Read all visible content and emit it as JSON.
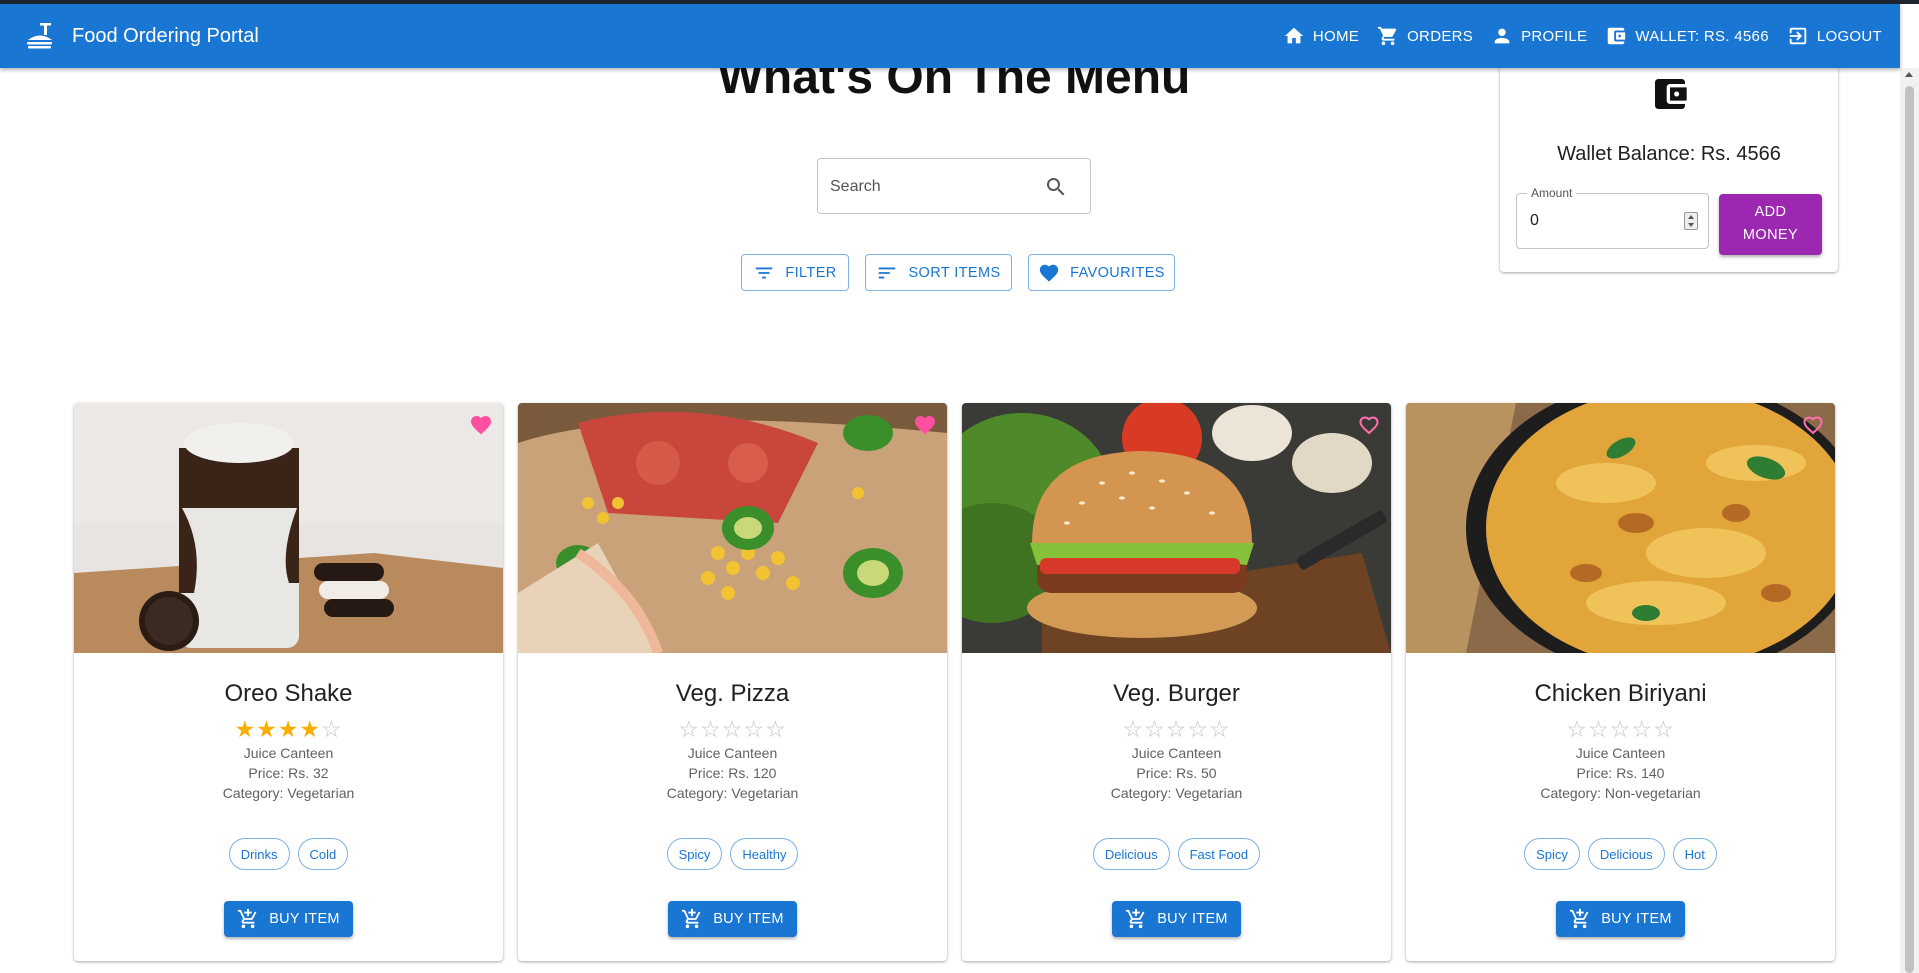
{
  "app": {
    "title": "Food Ordering Portal",
    "brand_color": "#1976d2"
  },
  "nav": {
    "home": "HOME",
    "orders": "ORDERS",
    "profile": "PROFILE",
    "wallet": "WALLET: RS. 4566",
    "logout": "LOGOUT"
  },
  "menu": {
    "title": "What's On The Menu",
    "search_placeholder": "Search",
    "filter_label": "FILTER",
    "sort_label": "SORT ITEMS",
    "favourites_label": "FAVOURITES"
  },
  "wallet": {
    "balance_text": "Wallet Balance: Rs. 4566",
    "amount_label": "Amount",
    "amount_value": "0",
    "add_money_line1": "ADD",
    "add_money_line2": "MONEY",
    "button_color": "#9c27b0"
  },
  "items": [
    {
      "name": "Oreo Shake",
      "rating": 4,
      "canteen": "Juice Canteen",
      "price": "Price: Rs. 32",
      "category": "Category: Vegetarian",
      "tags": [
        "Drinks",
        "Cold"
      ],
      "favourite": true,
      "buy_label": "BUY ITEM"
    },
    {
      "name": "Veg. Pizza",
      "rating": 0,
      "canteen": "Juice Canteen",
      "price": "Price: Rs. 120",
      "category": "Category: Vegetarian",
      "tags": [
        "Spicy",
        "Healthy"
      ],
      "favourite": true,
      "buy_label": "BUY ITEM"
    },
    {
      "name": "Veg. Burger",
      "rating": 0,
      "canteen": "Juice Canteen",
      "price": "Price: Rs. 50",
      "category": "Category: Vegetarian",
      "tags": [
        "Delicious",
        "Fast Food"
      ],
      "favourite": false,
      "buy_label": "BUY ITEM"
    },
    {
      "name": "Chicken Biriyani",
      "rating": 0,
      "canteen": "Juice Canteen",
      "price": "Price: Rs. 140",
      "category": "Category: Non-vegetarian",
      "tags": [
        "Spicy",
        "Delicious",
        "Hot"
      ],
      "favourite": false,
      "buy_label": "BUY ITEM"
    }
  ]
}
